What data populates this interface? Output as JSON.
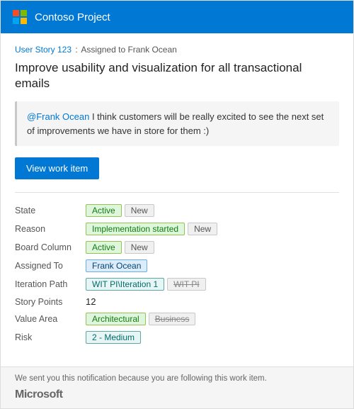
{
  "header": {
    "title": "Contoso Project",
    "logo_alt": "Microsoft logo"
  },
  "breadcrumb": {
    "link_text": "User Story 123",
    "separator": ":",
    "suffix": "Assigned to Frank Ocean"
  },
  "main_title": "Improve usability and visualization for all transactional emails",
  "comment": {
    "mention": "@Frank Ocean",
    "text": " I think customers will be really excited to see the next set of improvements we have in store for them :)"
  },
  "view_button": "View work item",
  "fields": [
    {
      "label": "State",
      "values": [
        {
          "text": "Active",
          "style": "green"
        },
        {
          "text": "New",
          "style": "gray"
        }
      ]
    },
    {
      "label": "Reason",
      "values": [
        {
          "text": "Implementation started",
          "style": "green"
        },
        {
          "text": "New",
          "style": "gray"
        }
      ]
    },
    {
      "label": "Board Column",
      "values": [
        {
          "text": "Active",
          "style": "green"
        },
        {
          "text": "New",
          "style": "gray"
        }
      ]
    },
    {
      "label": "Assigned To",
      "values": [
        {
          "text": "Frank Ocean",
          "style": "blue"
        }
      ]
    },
    {
      "label": "Iteration Path",
      "values": [
        {
          "text": "WIT PI\\Iteration 1",
          "style": "teal"
        },
        {
          "text": "WIT PI",
          "style": "strikethrough"
        }
      ]
    },
    {
      "label": "Story Points",
      "values": [
        {
          "text": "12",
          "style": "plain"
        }
      ]
    },
    {
      "label": "Value Area",
      "values": [
        {
          "text": "Architectural",
          "style": "green"
        },
        {
          "text": "Business",
          "style": "strikethrough"
        }
      ]
    },
    {
      "label": "Risk",
      "values": [
        {
          "text": "2 - Medium",
          "style": "teal"
        }
      ]
    }
  ],
  "footer": {
    "note": "We sent you this notification because you are following this work item.",
    "brand": "Microsoft"
  }
}
